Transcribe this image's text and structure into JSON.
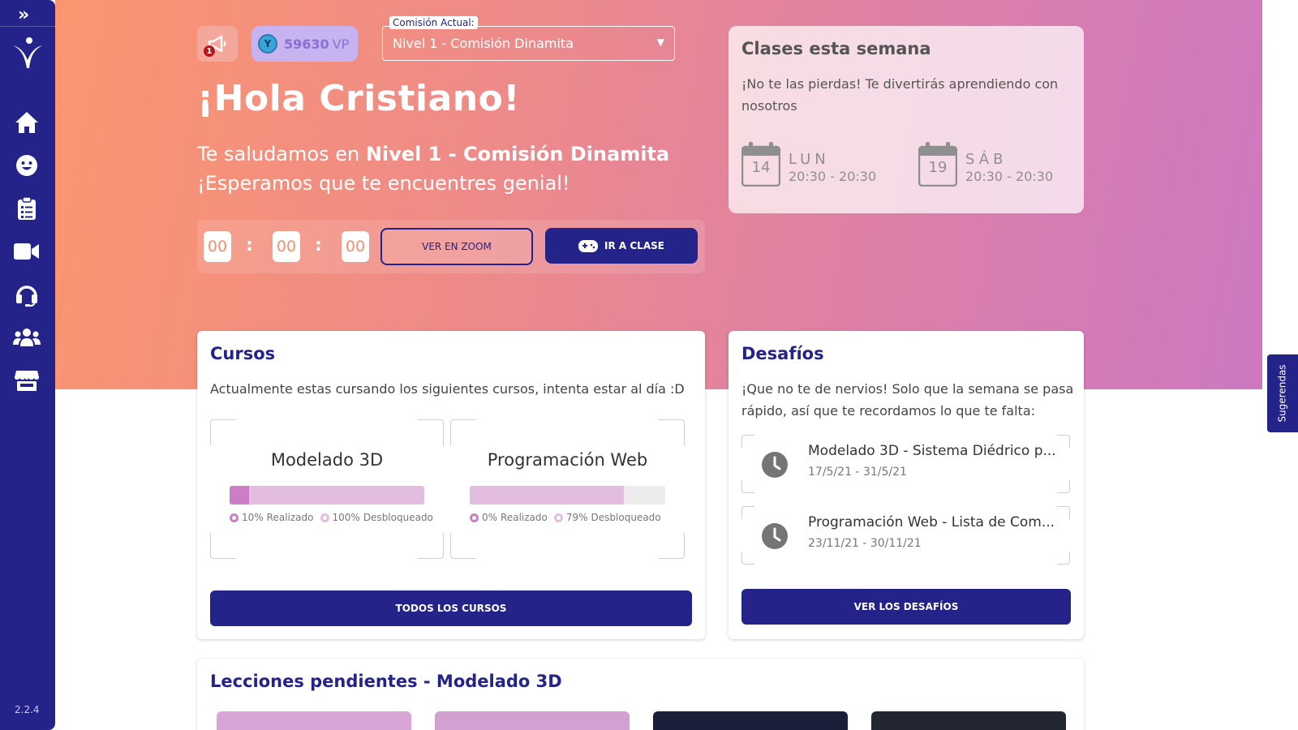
{
  "sidebar": {
    "expand_icon": "double-chevron-right-icon",
    "nav": [
      "home-icon",
      "smiley-icon",
      "clipboard-icon",
      "video-camera-icon",
      "headset-icon",
      "group-icon",
      "store-icon"
    ],
    "version": "2.2.4"
  },
  "header": {
    "notification_count": "1",
    "vp_points": "59630",
    "vp_unit": "VP",
    "commission_label": "Comisión Actual:",
    "commission_value": "Nivel 1 - Comisión Dinamita"
  },
  "hero": {
    "greeting": "¡Hola Cristiano!",
    "welcome_prefix": "Te saludamos en ",
    "welcome_level": "Nivel 1 - Comisión Dinamita",
    "wish": "¡Esperamos que te encuentres genial!"
  },
  "timer": {
    "hours": "00",
    "minutes": "00",
    "seconds": "00",
    "separator": ":"
  },
  "actions": {
    "zoom_label": "VER EN ZOOM",
    "class_label": "IR A CLASE"
  },
  "week": {
    "title": "Clases esta semana",
    "description": "¡No te las pierdas! Te divertirás aprendiendo con nosotros",
    "days": [
      {
        "num": "14",
        "name": "LUN",
        "time": "20:30 - 20:30"
      },
      {
        "num": "19",
        "name": "SÁB",
        "time": "20:30 - 20:30"
      }
    ]
  },
  "courses": {
    "title": "Cursos",
    "description": "Actualmente estas cursando los siguientes cursos, intenta estar al día :D",
    "items": [
      {
        "name": "Modelado 3D",
        "done_pct": 10,
        "unlock_pct": 100,
        "done_label": "10%",
        "done_text": " Realizado",
        "unlock_label": "100%",
        "unlock_text": " Desbloqueado"
      },
      {
        "name": "Programación Web",
        "done_pct": 0,
        "unlock_pct": 79,
        "done_label": "0%",
        "done_text": " Realizado",
        "unlock_label": "79%",
        "unlock_text": " Desbloqueado"
      }
    ],
    "all_button": "TODOS LOS CURSOS"
  },
  "challenges": {
    "title": "Desafíos",
    "description": "¡Que no te de nervios! Solo que la semana se pasa rápido, así que te recordamos lo que te falta:",
    "items": [
      {
        "title": "Modelado 3D - Sistema Diédrico p...",
        "dates": "17/5/21 - 31/5/21"
      },
      {
        "title": "Programación Web - Lista de Com...",
        "dates": "23/11/21 - 30/11/21"
      }
    ],
    "button": "VER LOS DESAFÍOS"
  },
  "lessons": {
    "title": "Lecciones pendientes - Modelado 3D"
  },
  "suggestions": {
    "label": "Sugerendas"
  },
  "colors": {
    "brand": "#23238a",
    "hero_start": "#fb9570",
    "hero_end": "#cd78c1",
    "progress_done": "#cc7dc6",
    "progress_unlock": "#e2bddf"
  }
}
